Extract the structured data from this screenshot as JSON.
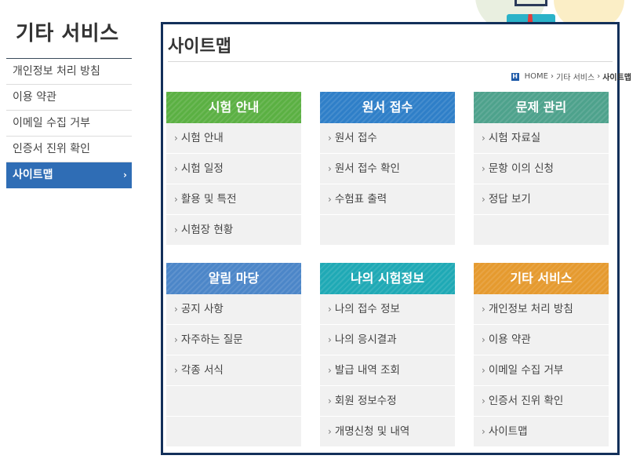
{
  "sidebar": {
    "title": "기타 서비스",
    "items": [
      {
        "label": "개인정보 처리 방침"
      },
      {
        "label": "이용 약관"
      },
      {
        "label": "이메일 수집 거부"
      },
      {
        "label": "인증서 진위 확인"
      },
      {
        "label": "사이트맵",
        "chevron": "›"
      }
    ]
  },
  "page": {
    "title": "사이트맵",
    "breadcrumb": {
      "home_icon": "H",
      "home": "HOME",
      "sep": "›",
      "section": "기타 서비스",
      "current": "사이트맵"
    }
  },
  "colors": {
    "green": "#5bb043",
    "blue": "#2f7fc8",
    "teal": "#4ea28c",
    "lightblue": "#4c86c8",
    "cyan": "#1fa9b5",
    "orange": "#e59a2f"
  },
  "sections": [
    {
      "title": "시험 안내",
      "items": [
        "시험 안내",
        "시험 일정",
        "활용 및 특전",
        "시험장 현황"
      ]
    },
    {
      "title": "원서 접수",
      "items": [
        "원서 접수",
        "원서 접수 확인",
        "수험표 출력"
      ]
    },
    {
      "title": "문제 관리",
      "items": [
        "시험 자료실",
        "문항 이의 신청",
        "정답 보기"
      ]
    },
    {
      "title": "알림 마당",
      "items": [
        "공지 사항",
        "자주하는 질문",
        "각종 서식"
      ]
    },
    {
      "title": "나의 시험정보",
      "items": [
        "나의 접수 정보",
        "나의 응시결과",
        "발급 내역 조회",
        "회원 정보수정",
        "개명신청 및 내역"
      ]
    },
    {
      "title": "기타 서비스",
      "items": [
        "개인정보 처리 방침",
        "이용 약관",
        "이메일 수집 거부",
        "인증서 진위 확인",
        "사이트맵"
      ]
    }
  ],
  "arrow": "›"
}
